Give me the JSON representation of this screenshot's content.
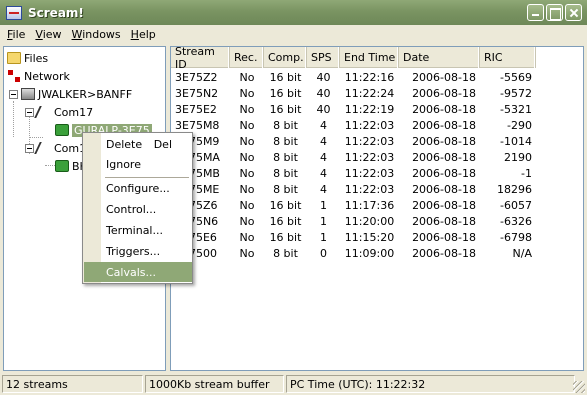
{
  "window": {
    "title": "Scream!"
  },
  "menu": [
    {
      "hot": "F",
      "rest": "ile"
    },
    {
      "hot": "V",
      "rest": "iew"
    },
    {
      "hot": "W",
      "rest": "indows"
    },
    {
      "hot": "H",
      "rest": "elp"
    }
  ],
  "tree": {
    "files": "Files",
    "network": "Network",
    "server": "JWALKER>BANFF",
    "com17": "Com17",
    "gcf1": "GURALP-3E75",
    "com18": "Com18",
    "gcf2": "BHU"
  },
  "columns": [
    "Stream ID",
    "Rec.",
    "Comp.",
    "SPS",
    "End Time",
    "Date",
    "RIC"
  ],
  "rows": [
    [
      "3E75Z2",
      "No",
      "16 bit",
      "40",
      "11:22:16",
      "2006-08-18",
      "-5569"
    ],
    [
      "3E75N2",
      "No",
      "16 bit",
      "40",
      "11:22:24",
      "2006-08-18",
      "-9572"
    ],
    [
      "3E75E2",
      "No",
      "16 bit",
      "40",
      "11:22:19",
      "2006-08-18",
      "-5321"
    ],
    [
      "3E75M8",
      "No",
      "8 bit",
      "4",
      "11:22:03",
      "2006-08-18",
      "-290"
    ],
    [
      "3E75M9",
      "No",
      "8 bit",
      "4",
      "11:22:03",
      "2006-08-18",
      "-1014"
    ],
    [
      "3E75MA",
      "No",
      "8 bit",
      "4",
      "11:22:03",
      "2006-08-18",
      "2190"
    ],
    [
      "3E75MB",
      "No",
      "8 bit",
      "4",
      "11:22:03",
      "2006-08-18",
      "-1"
    ],
    [
      "3E75ME",
      "No",
      "8 bit",
      "4",
      "11:22:03",
      "2006-08-18",
      "18296"
    ],
    [
      "3E75Z6",
      "No",
      "16 bit",
      "1",
      "11:17:36",
      "2006-08-18",
      "-6057"
    ],
    [
      "3E75N6",
      "No",
      "16 bit",
      "1",
      "11:20:00",
      "2006-08-18",
      "-6326"
    ],
    [
      "3E75E6",
      "No",
      "16 bit",
      "1",
      "11:15:20",
      "2006-08-18",
      "-6798"
    ],
    [
      "3E7500",
      "No",
      "8 bit",
      "0",
      "11:09:00",
      "2006-08-18",
      "N/A"
    ]
  ],
  "context_menu": {
    "delete": "Delete",
    "delete_shortcut": "Del",
    "ignore": "Ignore",
    "configure": "Configure...",
    "control": "Control...",
    "terminal": "Terminal...",
    "triggers": "Triggers...",
    "calvals": "Calvals..."
  },
  "status": {
    "streams": "12 streams",
    "buffer": "1000Kb stream buffer",
    "pc_time": "PC Time (UTC):  11:22:32"
  }
}
